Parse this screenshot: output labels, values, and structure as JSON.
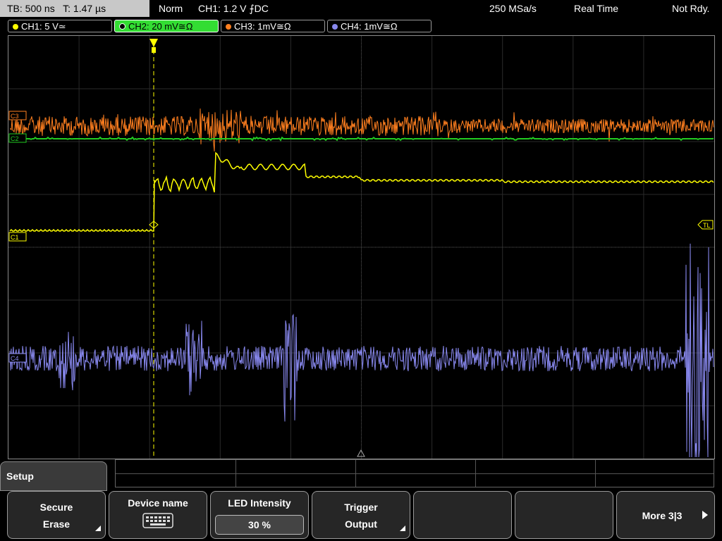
{
  "topbar": {
    "timebase": "TB: 500 ns",
    "trigger_time": "T: 1.47 µs",
    "mode": "Norm",
    "trigger_info": "CH1: 1.2 V ⨍DC",
    "sample_rate": "250 MSa/s",
    "acq_mode": "Real Time",
    "status": "Not Rdy."
  },
  "channels": [
    {
      "label": "CH1: 5 V≃",
      "color": "#ffff00",
      "active": false
    },
    {
      "label": "CH2: 20 mV≅Ω",
      "color": "#22cc22",
      "active": true
    },
    {
      "label": "CH3: 1mV≅Ω",
      "color": "#ff7f1f",
      "active": false
    },
    {
      "label": "CH4: 1mV≅Ω",
      "color": "#8888ee",
      "active": false
    }
  ],
  "markers": {
    "c3": "C3",
    "c2": "C2",
    "c1": "C1",
    "c4": "C4",
    "tl": "TL"
  },
  "menu": {
    "title": "Setup",
    "buttons": [
      {
        "l1": "Secure",
        "l2": "Erase",
        "corner": true
      },
      {
        "l1": "Device name",
        "icon": "keyboard-icon"
      },
      {
        "l1": "LED Intensity",
        "value": "30 %"
      },
      {
        "l1": "Trigger",
        "l2": "Output",
        "corner": true
      },
      {
        "l1": ""
      },
      {
        "l1": ""
      },
      {
        "l1": "More 3|3",
        "arrow": true
      }
    ]
  }
}
